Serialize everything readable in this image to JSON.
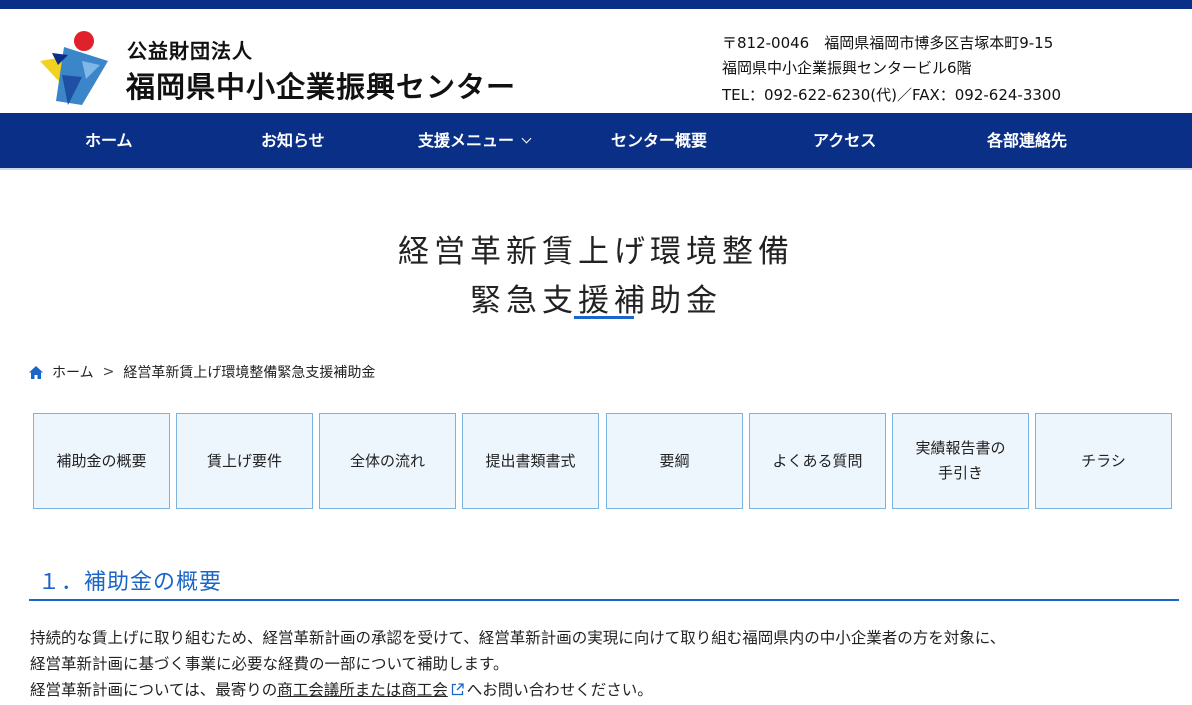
{
  "header": {
    "org_sub": "公益財団法人",
    "org_main": "福岡県中小企業振興センター",
    "address_line1": "〒812-0046　福岡県福岡市博多区吉塚本町9-15",
    "address_line2": "福岡県中小企業振興センタービル6階",
    "address_line3": "TEL：092-622-6230(代)／FAX：092-624-3300"
  },
  "nav": {
    "items": [
      {
        "label": "ホーム"
      },
      {
        "label": "お知らせ"
      },
      {
        "label": "支援メニュー"
      },
      {
        "label": "センター概要"
      },
      {
        "label": "アクセス"
      },
      {
        "label": "各部連絡先"
      }
    ]
  },
  "page": {
    "title_line1": "経営革新賃上げ環境整備",
    "title_line2": "緊急支援補助金"
  },
  "breadcrumb": {
    "home": "ホーム",
    "separator": ">",
    "current": "経営革新賃上げ環境整備緊急支援補助金"
  },
  "tabs": [
    {
      "label": "補助金の概要"
    },
    {
      "label": "賃上げ要件"
    },
    {
      "label": "全体の流れ"
    },
    {
      "label": "提出書類書式"
    },
    {
      "label": "要綱"
    },
    {
      "label": "よくある質問"
    },
    {
      "label": "実績報告書の\n手引き"
    },
    {
      "label": "チラシ"
    }
  ],
  "section": {
    "heading": "１．補助金の概要",
    "para1": "持続的な賃上げに取り組むため、経営革新計画の承認を受けて、経営革新計画の実現に向けて取り組む福岡県内の中小企業者の方を対象に、",
    "para2": "経営革新計画に基づく事業に必要な経費の一部について補助します。",
    "para3_pre": "経営革新計画については、最寄りの",
    "para3_link": "商工会議所または商工会",
    "para3_post": "へお問い合わせください。"
  },
  "colors": {
    "brand_navy": "#0a2f86",
    "accent_blue": "#1a66c8",
    "tab_bg": "#eef6fd",
    "tab_border": "#7ab3df"
  },
  "icons": {
    "logo": "fukuoka-sme-center-logo",
    "home": "home-icon",
    "dropdown": "chevron-down-icon",
    "external": "external-link-icon"
  }
}
